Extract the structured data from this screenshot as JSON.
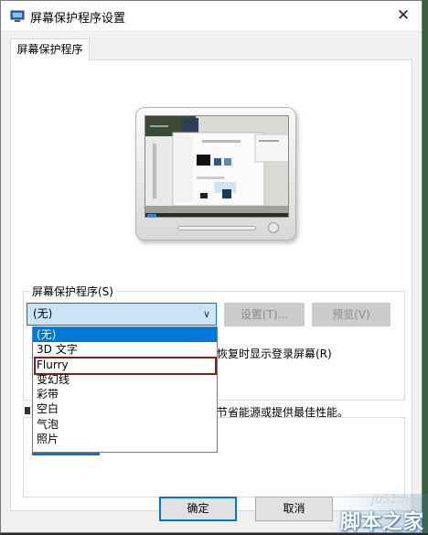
{
  "window": {
    "title": "屏幕保护程序设置",
    "close_glyph": "✕"
  },
  "tabs": [
    {
      "label": "屏幕保护程序"
    }
  ],
  "screensaver": {
    "group_label": "屏幕保护程序(S)",
    "selected": "(无)",
    "settings_button": "设置(T)...",
    "preview_button": "预览(V)",
    "dropdown_options": [
      "(无)",
      "3D 文字",
      "Flurry",
      "变幻线",
      "彩带",
      "空白",
      "气泡",
      "照片"
    ],
    "dropdown_highlighted_index": 0,
    "dropdown_outlined_index": 2,
    "partial_text_logon": "恢复时显示登录屏幕(R)"
  },
  "power": {
    "partial_text": "节省能源或提供最佳性能。"
  },
  "footer": {
    "ok_button": "确定",
    "cancel_button": "取消"
  },
  "watermark": {
    "url": "jb51.net",
    "brand": "脚本之家"
  },
  "colors": {
    "accent": "#0078d7",
    "outline": "#8b1a1a",
    "disabled_button": "#cccccc"
  }
}
